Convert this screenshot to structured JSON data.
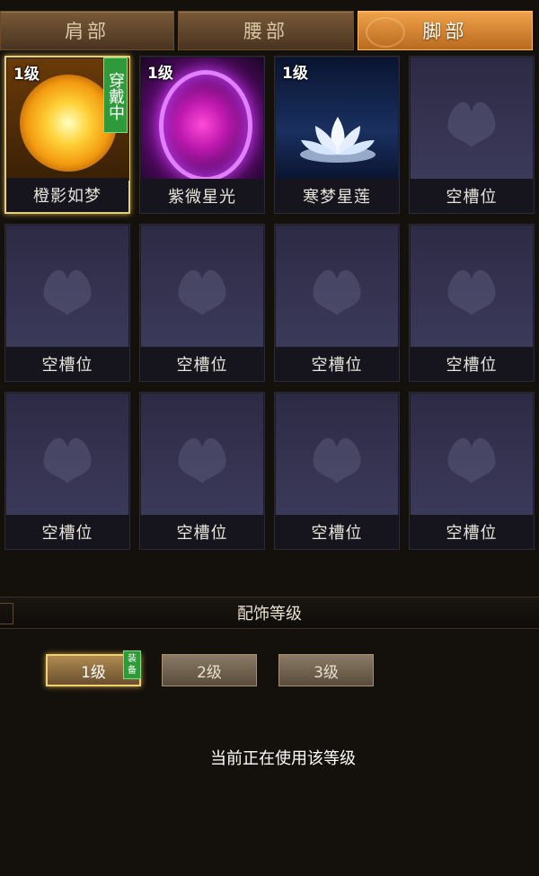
{
  "tabs": [
    {
      "label": "肩部",
      "active": false
    },
    {
      "label": "腰部",
      "active": false
    },
    {
      "label": "脚部",
      "active": true
    }
  ],
  "items": [
    {
      "name": "橙影如梦",
      "level": "1级",
      "badge": "穿戴中",
      "art": "golden-sun",
      "selected": true
    },
    {
      "name": "紫微星光",
      "level": "1级",
      "badge": "",
      "art": "purple-ring"
    },
    {
      "name": "寒梦星莲",
      "level": "1级",
      "badge": "",
      "art": "white-lotus"
    },
    {
      "name": "空槽位",
      "art": "butterfly-icon"
    },
    {
      "name": "空槽位",
      "art": "butterfly-icon"
    },
    {
      "name": "空槽位",
      "art": "butterfly-icon"
    },
    {
      "name": "空槽位",
      "art": "butterfly-icon"
    },
    {
      "name": "空槽位",
      "art": "butterfly-icon"
    },
    {
      "name": "空槽位",
      "art": "butterfly-icon"
    },
    {
      "name": "空槽位",
      "art": "butterfly-icon"
    },
    {
      "name": "空槽位",
      "art": "butterfly-icon"
    },
    {
      "name": "空槽位",
      "art": "butterfly-icon"
    }
  ],
  "level_section": {
    "title": "配饰等级",
    "buttons": [
      {
        "label": "1级",
        "active": true
      },
      {
        "label": "2级",
        "active": false
      },
      {
        "label": "3级",
        "active": false
      }
    ],
    "equipped_tag": "装备",
    "status": "当前正在使用该等级"
  },
  "colors": {
    "accent": "#f0a24a",
    "selected_border": "#e6cf7a",
    "wear_badge": "#2e9a3a",
    "background": "#14100c"
  }
}
